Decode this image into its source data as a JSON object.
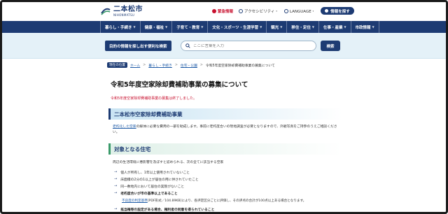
{
  "header": {
    "logo_jp": "二本松市",
    "logo_en": "NIHONMATSU",
    "emergency_label": "緊急情報",
    "accessibility_label": "アクセシビリティ・",
    "language_label": "LANGUAGE・",
    "find_info_button": "情報を探す"
  },
  "nav": {
    "items": [
      {
        "label": "暮らし・手続き"
      },
      {
        "label": "健康・福祉"
      },
      {
        "label": "子育て・教育"
      },
      {
        "label": "文化・スポーツ・生涯学習"
      },
      {
        "label": "観光"
      },
      {
        "label": "移住・定住"
      },
      {
        "label": "仕事・産業"
      },
      {
        "label": "市政情報"
      }
    ]
  },
  "search": {
    "band_label": "目的の情報を探し出す便利な検索",
    "placeholder": "ここに言葉を入力",
    "button_label": "検索"
  },
  "breadcrumb": {
    "current_tag": "現在の位置",
    "items": [
      "ホーム",
      "暮らし・手続き",
      "住宅・公園"
    ],
    "current": "令和5年度空家除却費補助事業の募集について"
  },
  "main": {
    "title": "令和5年度空家除却費補助事業の募集について",
    "notice": "令和5年度空家除却費補助事業の募集は終了しました。",
    "section1_heading": "二本松市空家除却費補助事業",
    "section1_link": "老朽化した空家",
    "section1_text": "の解体に必要な費用の一部を助成します。事前に老朽度合いの現地調査が必要となりますので、外観写真をご持参のうえご相談ください。",
    "section2_heading": "対象となる住宅",
    "section2_text": "周辺の生活環境に悪影響を及ぼすと認められる、次の全てに該当する空家",
    "conditions": [
      {
        "text": "個人が所有し、1年以上使用されていないこと"
      },
      {
        "text": "床面積の2分の1以上が居住の用に供されていたこと"
      },
      {
        "text": "同一敷地内において居住の実態がないこと"
      },
      {
        "text": "老朽度合いが市の基準以上であること"
      }
    ],
    "condition_sub_link": "不良度の判定基準",
    "condition_sub_text": "[PDF形式／104.89KB]により、各評定区分ごとに評価し、その評点の合計が100点以上ある場合となります。",
    "condition_last": "抵当権等の設定がある場合、権利者の同意を得られていること"
  },
  "colors": {
    "brand_navy": "#1d3b73",
    "emergency_red": "#c8102e",
    "search_band": "#e4f1f8"
  }
}
